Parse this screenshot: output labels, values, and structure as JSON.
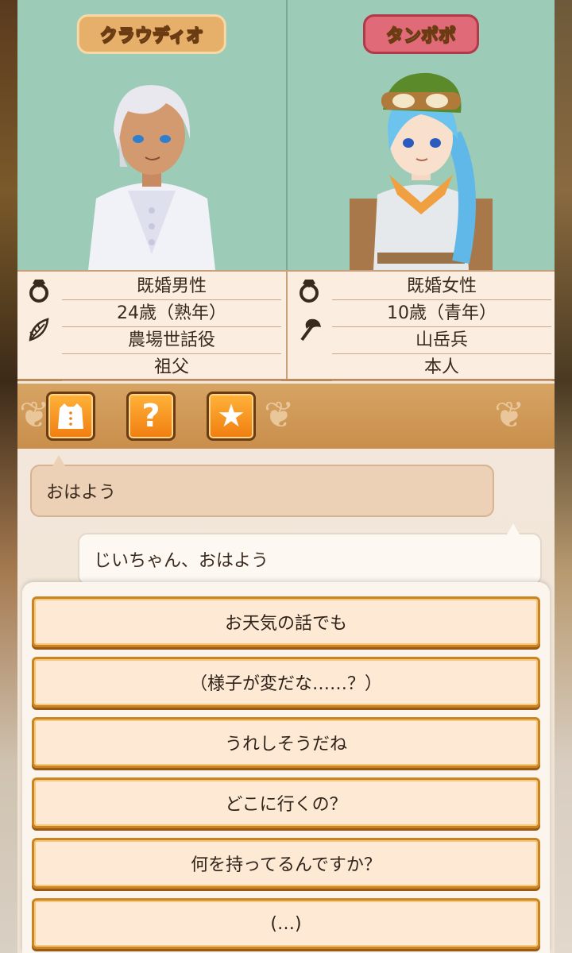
{
  "characters": {
    "left": {
      "name": "クラウディオ",
      "info": [
        "既婚男性",
        "24歳（熟年）",
        "農場世話役",
        "祖父"
      ],
      "icons": [
        "ring-icon",
        "leaf-icon"
      ]
    },
    "right": {
      "name": "タンポポ",
      "info": [
        "既婚女性",
        "10歳（青年）",
        "山岳兵",
        "本人"
      ],
      "icons": [
        "ring-icon",
        "axe-icon"
      ]
    }
  },
  "toolbar": {
    "buttons": [
      {
        "icon": "clothes-icon"
      },
      {
        "icon": "question-icon",
        "glyph": "?"
      },
      {
        "icon": "star-icon",
        "glyph": "★"
      }
    ]
  },
  "dialogue": {
    "line1": "おはよう",
    "line2": "じいちゃん、おはよう"
  },
  "choices": [
    "お天気の話でも",
    "（様子が変だな……？）",
    "うれしそうだね",
    "どこに行くの？",
    "何を持ってるんですか？",
    "(…)"
  ],
  "colors": {
    "portrait_bg": "#9ccbb8",
    "toolbar_bg": "#d19a5a",
    "button_orange": "#f07d10",
    "choice_border": "#c98524"
  }
}
